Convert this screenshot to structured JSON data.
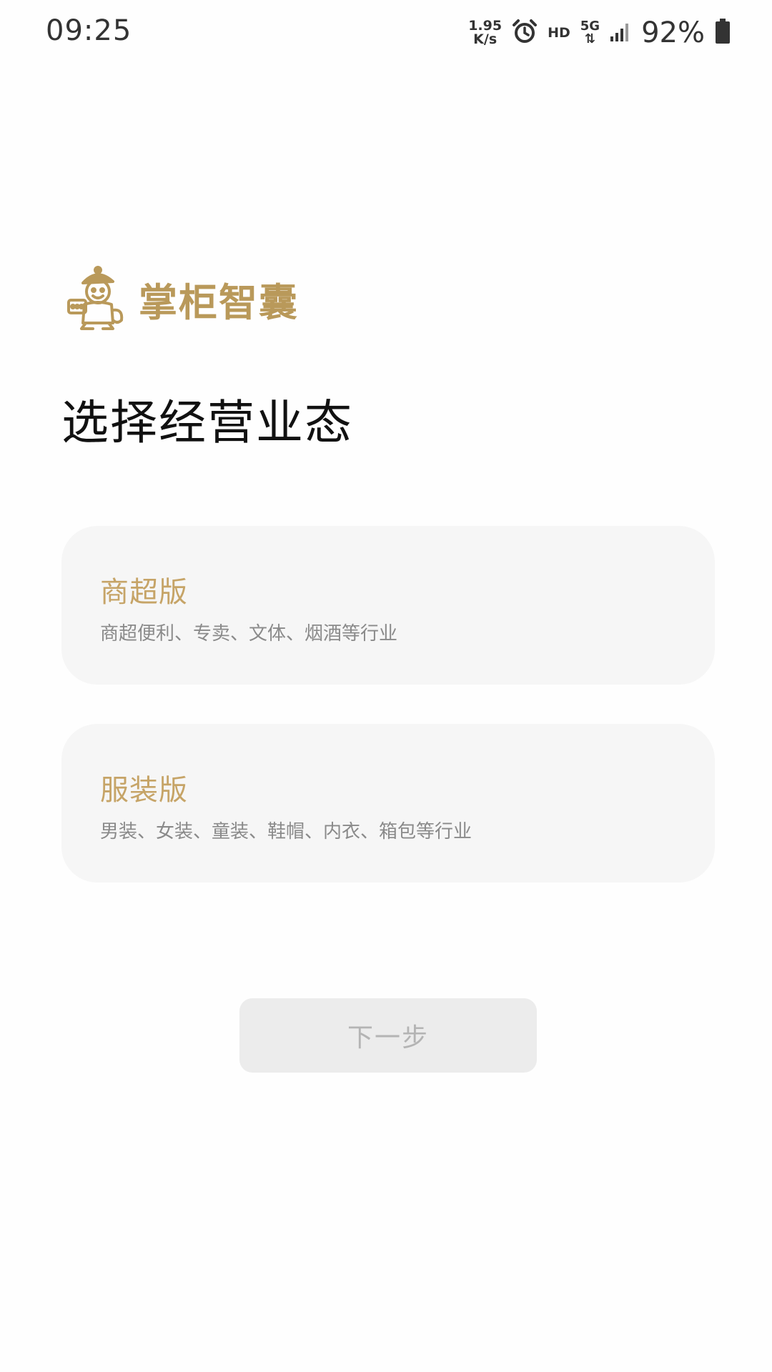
{
  "status_bar": {
    "time": "09:25",
    "net_speed_value": "1.95",
    "net_speed_unit": "K/s",
    "hd_label": "HD",
    "network_label": "5G",
    "battery_percent": "92%",
    "icons": [
      "alarm-icon",
      "signal-icon",
      "battery-icon"
    ]
  },
  "logo": {
    "text": "掌柜智囊",
    "mascot_icon": "mascot-icon"
  },
  "page": {
    "title": "选择经营业态"
  },
  "options": [
    {
      "title": "商超版",
      "description": "商超便利、专卖、文体、烟酒等行业"
    },
    {
      "title": "服装版",
      "description": "男装、女装、童装、鞋帽、内衣、箱包等行业"
    }
  ],
  "next_button": {
    "label": "下一步"
  },
  "colors": {
    "accent_gold": "#c6a467",
    "logo_gold": "#b9995a",
    "card_bg": "#f6f6f6",
    "button_disabled_bg": "#ececec",
    "button_disabled_text": "#b4b4b4",
    "description_text": "#8a8a8a"
  }
}
